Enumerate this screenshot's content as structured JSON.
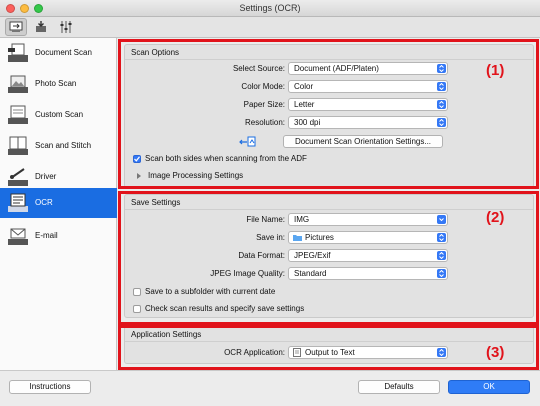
{
  "window": {
    "title": "Settings (OCR)"
  },
  "toolbar": {
    "icons": [
      "scan-from-computer-icon",
      "scan-from-operation-panel-icon",
      "general-settings-icon"
    ]
  },
  "sidebar": {
    "items": [
      {
        "label": "Document Scan",
        "icon": "document-scan-icon"
      },
      {
        "label": "Photo Scan",
        "icon": "photo-scan-icon"
      },
      {
        "label": "Custom Scan",
        "icon": "custom-scan-icon"
      },
      {
        "label": "Scan and Stitch",
        "icon": "scan-and-stitch-icon"
      },
      {
        "label": "Driver",
        "icon": "driver-icon"
      },
      {
        "label": "OCR",
        "icon": "ocr-icon",
        "selected": true
      },
      {
        "label": "E-mail",
        "icon": "email-icon"
      }
    ]
  },
  "scan_options": {
    "title": "Scan Options",
    "callout": "(1)",
    "select_source": {
      "label": "Select Source:",
      "value": "Document (ADF/Platen)"
    },
    "color_mode": {
      "label": "Color Mode:",
      "value": "Color"
    },
    "paper_size": {
      "label": "Paper Size:",
      "value": "Letter"
    },
    "resolution": {
      "label": "Resolution:",
      "value": "300 dpi"
    },
    "orientation_button": "Document Scan Orientation Settings...",
    "scan_both_sides": {
      "label": "Scan both sides when scanning from the ADF",
      "checked": true
    },
    "image_processing": "Image Processing Settings"
  },
  "save_settings": {
    "title": "Save Settings",
    "callout": "(2)",
    "file_name": {
      "label": "File Name:",
      "value": "IMG"
    },
    "save_in": {
      "label": "Save in:",
      "value": "Pictures"
    },
    "data_format": {
      "label": "Data Format:",
      "value": "JPEG/Exif"
    },
    "jpeg_quality": {
      "label": "JPEG Image Quality:",
      "value": "Standard"
    },
    "subfolder": {
      "label": "Save to a subfolder with current date",
      "checked": false
    },
    "check_results": {
      "label": "Check scan results and specify save settings",
      "checked": false
    }
  },
  "application_settings": {
    "title": "Application Settings",
    "callout": "(3)",
    "ocr_application": {
      "label": "OCR Application:",
      "value": "Output to Text"
    }
  },
  "footer": {
    "instructions": "Instructions",
    "defaults": "Defaults",
    "ok": "OK"
  },
  "colors": {
    "accent": "#1a6de2",
    "callout": "#e1131b",
    "ok_button": "#2f7cf6"
  }
}
